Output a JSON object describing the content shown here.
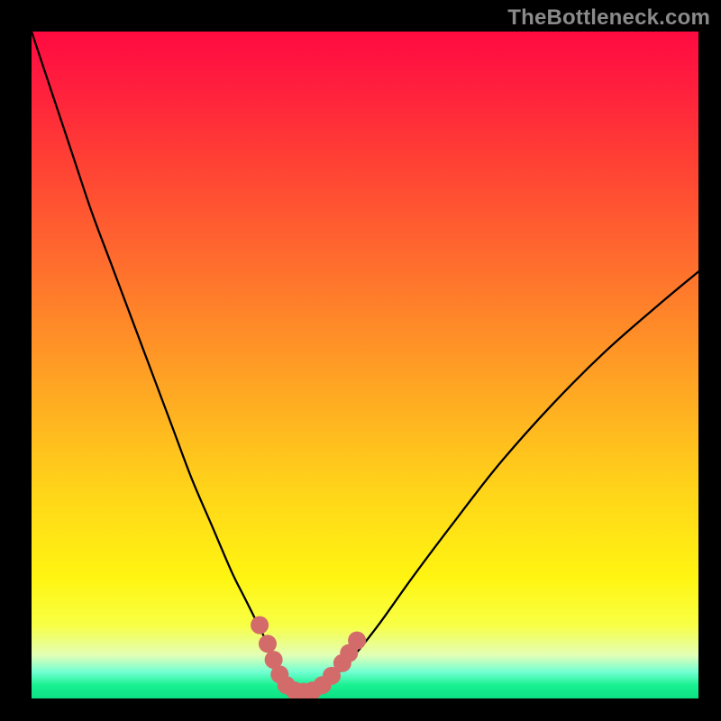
{
  "watermark": "TheBottleneck.com",
  "colors": {
    "curve": "#000000",
    "marker": "#d36b6b",
    "bg_top": "#ff0a40",
    "bg_bottom": "#0ce084"
  },
  "chart_data": {
    "type": "line",
    "title": "",
    "xlabel": "",
    "ylabel": "",
    "xlim": [
      0,
      100
    ],
    "ylim": [
      0,
      100
    ],
    "grid": false,
    "series": [
      {
        "name": "bottleneck-curve",
        "x": [
          0,
          3,
          6,
          9,
          12,
          15,
          18,
          21,
          24,
          27,
          30,
          32,
          34,
          36,
          37,
          38,
          39,
          40,
          41,
          42,
          43,
          45,
          48,
          52,
          57,
          63,
          70,
          78,
          86,
          94,
          100
        ],
        "y": [
          100,
          91,
          82,
          73,
          65,
          57,
          49,
          41,
          33,
          26,
          19,
          15,
          11,
          7,
          5,
          3.2,
          2,
          1.3,
          1,
          1.2,
          1.8,
          3,
          6,
          11,
          18,
          26,
          35,
          44,
          52,
          59,
          64
        ]
      }
    ],
    "markers": {
      "series": "bottleneck-curve",
      "points": [
        {
          "x": 34.2,
          "y": 11.0
        },
        {
          "x": 35.4,
          "y": 8.2
        },
        {
          "x": 36.3,
          "y": 5.8
        },
        {
          "x": 37.2,
          "y": 3.6
        },
        {
          "x": 38.2,
          "y": 2.0
        },
        {
          "x": 39.4,
          "y": 1.2
        },
        {
          "x": 40.8,
          "y": 1.0
        },
        {
          "x": 42.2,
          "y": 1.2
        },
        {
          "x": 43.6,
          "y": 2.0
        },
        {
          "x": 45.0,
          "y": 3.4
        },
        {
          "x": 46.6,
          "y": 5.3
        },
        {
          "x": 47.6,
          "y": 6.8
        },
        {
          "x": 48.8,
          "y": 8.7
        }
      ]
    }
  }
}
